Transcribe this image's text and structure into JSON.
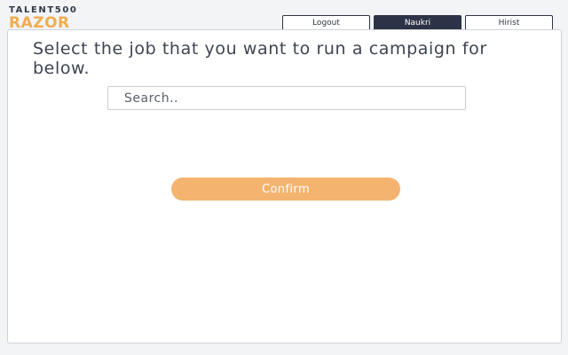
{
  "logo": {
    "top": "TALENT500",
    "main": "RAZOR"
  },
  "tabs": [
    {
      "label": "Logout",
      "active": false
    },
    {
      "label": "Naukri",
      "active": true
    },
    {
      "label": "Hirist",
      "active": false
    }
  ],
  "main": {
    "heading": "Select the job that you want to run a campaign for below.",
    "search": {
      "placeholder": "Search..",
      "value": ""
    },
    "confirm_label": "Confirm"
  },
  "colors": {
    "brand_orange": "#f0ad4e",
    "button_orange": "#f4b46f",
    "active_tab": "#2d3346"
  }
}
